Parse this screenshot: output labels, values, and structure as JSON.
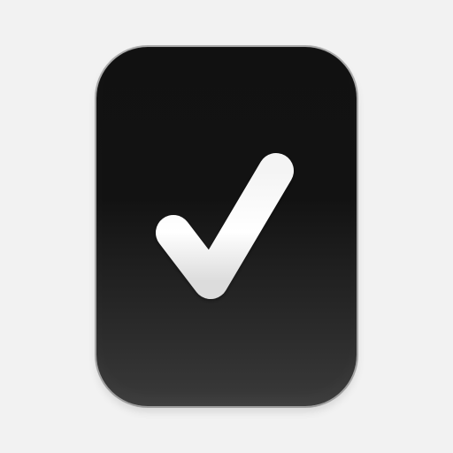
{
  "icon": {
    "name": "checkmark-icon",
    "background": "#f2f2f2",
    "tile_colors": [
      "#111111",
      "#2a2a2a",
      "#3a3a3a"
    ],
    "check_color": "#ffffff"
  }
}
